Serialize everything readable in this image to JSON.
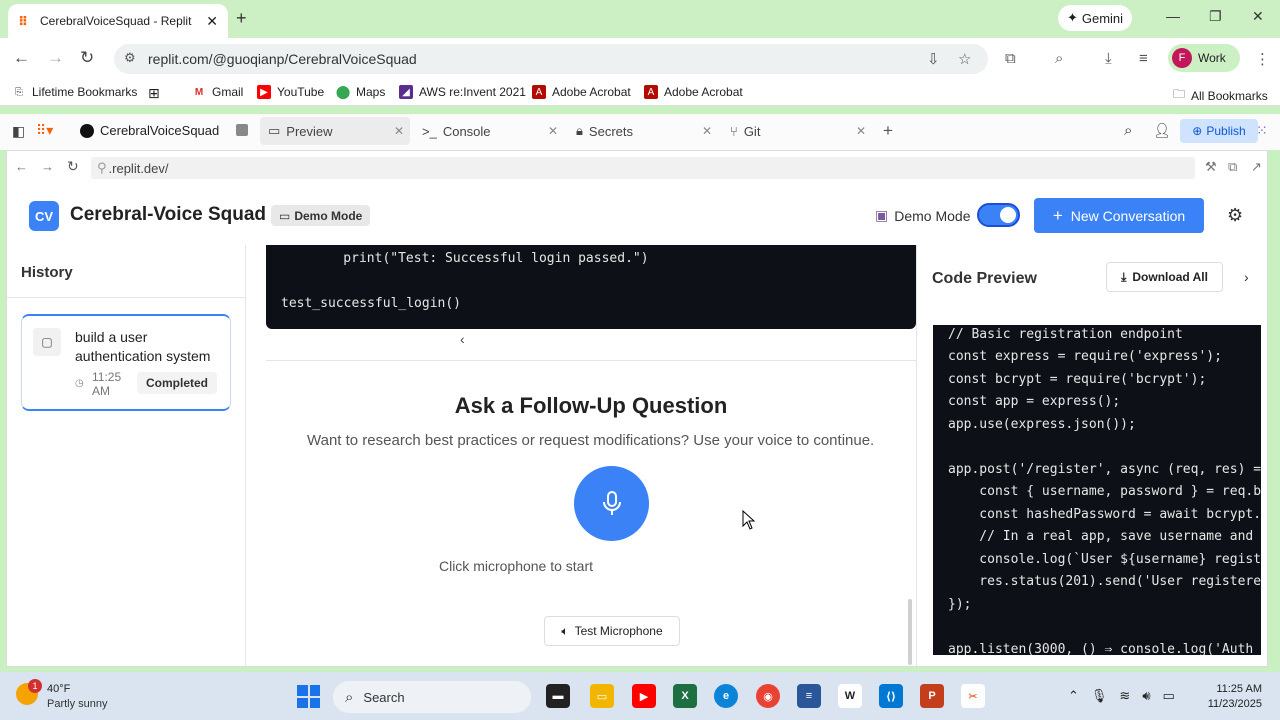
{
  "browser": {
    "tab_title": "CerebralVoiceSquad - Replit",
    "gemini_label": "Gemini",
    "url": "replit.com/@guoqianp/CerebralVoiceSquad",
    "profile_label": "Work",
    "profile_initial": "F"
  },
  "bookmarks": [
    {
      "label": "Lifetime Bookmarks"
    },
    {
      "label": "Gmail"
    },
    {
      "label": "YouTube"
    },
    {
      "label": "Maps"
    },
    {
      "label": "AWS re:Invent 2021"
    },
    {
      "label": "Adobe Acrobat"
    },
    {
      "label": "Adobe Acrobat"
    }
  ],
  "all_bookmarks_label": "All Bookmarks",
  "replit": {
    "project_name": "CerebralVoiceSquad",
    "tabs": [
      {
        "label": "Preview"
      },
      {
        "label": "Console"
      },
      {
        "label": "Secrets"
      },
      {
        "label": "Git"
      }
    ],
    "publish_label": "Publish",
    "webview_url": ".replit.dev/"
  },
  "app": {
    "logo_text": "CV",
    "title": "Cerebral-Voice Squad",
    "demo_badge": "Demo Mode",
    "demo_toggle_label": "Demo Mode",
    "demo_toggle_on": true,
    "new_conversation_label": "New Conversation"
  },
  "sidebar": {
    "title": "History",
    "items": [
      {
        "title": "build a user authentication system",
        "time": "11:25 AM",
        "status": "Completed"
      }
    ]
  },
  "main": {
    "code_lines": [
      "    print(\"Test: Successful login passed.\")",
      "test_successful_login()"
    ],
    "ask_title": "Ask a Follow-Up Question",
    "ask_subtitle": "Want to research best practices or request modifications? Use your voice to continue.",
    "mic_caption": "Click microphone to start",
    "test_mic_label": "Test Microphone"
  },
  "code_preview": {
    "title": "Code Preview",
    "download_label": "Download All",
    "lines": [
      "// Basic registration endpoint",
      "const express = require('express');",
      "const bcrypt = require('bcrypt');",
      "const app = express();",
      "app.use(express.json());",
      "",
      "app.post('/register', async (req, res) =",
      "    const { username, password } = req.b",
      "    const hashedPassword = await bcrypt.",
      "    // In a real app, save username and",
      "    console.log(`User ${username} regist",
      "    res.status(201).send('User registere",
      "});",
      "",
      "app.listen(3000, () ⇒ console.log('Auth"
    ]
  },
  "taskbar": {
    "weather_temp": "40°F",
    "weather_desc": "Partly sunny",
    "weather_badge": "1",
    "search_label": "Search",
    "time": "11:25 AM",
    "date": "11/23/2025"
  }
}
